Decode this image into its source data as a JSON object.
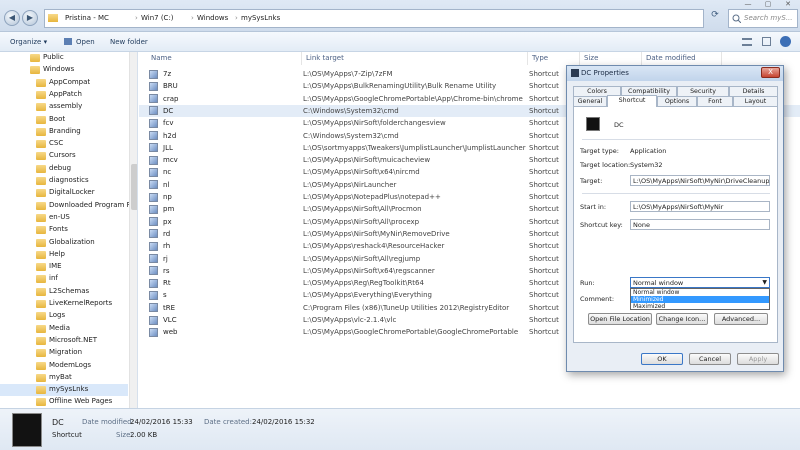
{
  "window": {
    "minimize_label": "—",
    "maximize_label": "▢",
    "close_label": "✕"
  },
  "address": {
    "back_glyph": "◀",
    "forward_glyph": "▶",
    "crumbs": [
      "Pristina - MC",
      "Win7 (C:)",
      "Windows",
      "mySysLnks"
    ],
    "refresh_glyph": "⟳",
    "search_placeholder": "Search myS..."
  },
  "toolbar": {
    "organize": "Organize ▾",
    "open": "Open",
    "new_folder": "New folder"
  },
  "nav": {
    "items": [
      "Public",
      "Windows",
      "AppCompat",
      "AppPatch",
      "assembly",
      "Boot",
      "Branding",
      "CSC",
      "Cursors",
      "debug",
      "diagnostics",
      "DigitalLocker",
      "Downloaded Program Files",
      "en-US",
      "Fonts",
      "Globalization",
      "Help",
      "IME",
      "inf",
      "L2Schemas",
      "LiveKernelReports",
      "Logs",
      "Media",
      "Microsoft.NET",
      "Migration",
      "ModemLogs",
      "myBat",
      "mySysLnks",
      "Offline Web Pages"
    ]
  },
  "list": {
    "headers": {
      "name": "Name",
      "target": "Link target",
      "type": "Type",
      "size": "Size",
      "date": "Date modified"
    },
    "rows": [
      {
        "name": "7z",
        "target": "L:\\OS\\MyApps\\7-Zip\\7zFM",
        "type": "Shortcut"
      },
      {
        "name": "BRU",
        "target": "L:\\OS\\MyApps\\BulkRenamingUtility\\Bulk Rename Utility",
        "type": "Shortcut"
      },
      {
        "name": "crap",
        "target": "L:\\OS\\MyApps\\GoogleChromePortable\\App\\Chrome-bin\\chrome",
        "type": "Shortcut"
      },
      {
        "name": "DC",
        "target": "C:\\Windows\\System32\\cmd",
        "type": "Shortcut"
      },
      {
        "name": "fcv",
        "target": "L:\\OS\\MyApps\\NirSoft\\folderchangesview",
        "type": "Shortcut"
      },
      {
        "name": "h2d",
        "target": "C:\\Windows\\System32\\cmd",
        "type": "Shortcut"
      },
      {
        "name": "JLL",
        "target": "L:\\OS\\sortmyapps\\Tweakers\\JumplistLauncher\\JumplistLauncher",
        "type": "Shortcut"
      },
      {
        "name": "mcv",
        "target": "L:\\OS\\MyApps\\NirSoft\\muicacheview",
        "type": "Shortcut"
      },
      {
        "name": "nc",
        "target": "L:\\OS\\MyApps\\NirSoft\\x64\\nircmd",
        "type": "Shortcut"
      },
      {
        "name": "nl",
        "target": "L:\\OS\\MyApps\\NirLauncher",
        "type": "Shortcut"
      },
      {
        "name": "np",
        "target": "L:\\OS\\MyApps\\NotepadPlus\\notepad++",
        "type": "Shortcut"
      },
      {
        "name": "pm",
        "target": "L:\\OS\\MyApps\\NirSoft\\All\\Procmon",
        "type": "Shortcut"
      },
      {
        "name": "px",
        "target": "L:\\OS\\MyApps\\NirSoft\\All\\procexp",
        "type": "Shortcut"
      },
      {
        "name": "rd",
        "target": "L:\\OS\\MyApps\\NirSoft\\MyNir\\RemoveDrive",
        "type": "Shortcut"
      },
      {
        "name": "rh",
        "target": "L:\\OS\\MyApps\\reshack4\\ResourceHacker",
        "type": "Shortcut"
      },
      {
        "name": "rj",
        "target": "L:\\OS\\MyApps\\NirSoft\\All\\regjump",
        "type": "Shortcut"
      },
      {
        "name": "rs",
        "target": "L:\\OS\\MyApps\\NirSoft\\x64\\regscanner",
        "type": "Shortcut"
      },
      {
        "name": "Rt",
        "target": "L:\\OS\\MyApps\\Reg\\RegToolkit\\Rt64",
        "type": "Shortcut"
      },
      {
        "name": "s",
        "target": "L:\\OS\\MyApps\\Everything\\Everything",
        "type": "Shortcut"
      },
      {
        "name": "tRE",
        "target": "C:\\Program Files (x86)\\TuneUp Utilities 2012\\RegistryEditor",
        "type": "Shortcut"
      },
      {
        "name": "VLC",
        "target": "L:\\OS\\MyApps\\vlc-2.1.4\\vlc",
        "type": "Shortcut"
      },
      {
        "name": "web",
        "target": "L:\\OS\\MyApps\\GoogleChromePortable\\GoogleChromePortable",
        "type": "Shortcut"
      }
    ]
  },
  "details": {
    "name": "DC",
    "type": "Shortcut",
    "date_modified_label": "Date modified:",
    "date_modified": "24/02/2016 15:33",
    "size_label": "Size:",
    "size": "2.00 KB",
    "date_created_label": "Date created:",
    "date_created": "24/02/2016 15:32"
  },
  "dialog": {
    "title": "DC Properties",
    "close": "X",
    "tabs_row1": [
      "Colors",
      "Compatibility",
      "Security",
      "Details"
    ],
    "tabs_row2": [
      "General",
      "Shortcut",
      "Options",
      "Font",
      "Layout"
    ],
    "icon_name": "DC",
    "target_type_label": "Target type:",
    "target_type": "Application",
    "target_location_label": "Target location:",
    "target_location": "System32",
    "target_label": "Target:",
    "target": "L:\\OS\\MyApps\\NirSoft\\MyNir\\DriveCleanup.exe",
    "start_in_label": "Start in:",
    "start_in": "L:\\OS\\MyApps\\NirSoft\\MyNir",
    "shortcut_key_label": "Shortcut key:",
    "shortcut_key": "None",
    "run_label": "Run:",
    "run_value": "Normal window",
    "run_options": [
      "Normal window",
      "Minimized",
      "Maximized"
    ],
    "comment_label": "Comment:",
    "open_location": "Open File Location",
    "change_icon": "Change Icon...",
    "advanced": "Advanced...",
    "ok": "OK",
    "cancel": "Cancel",
    "apply": "Apply"
  }
}
